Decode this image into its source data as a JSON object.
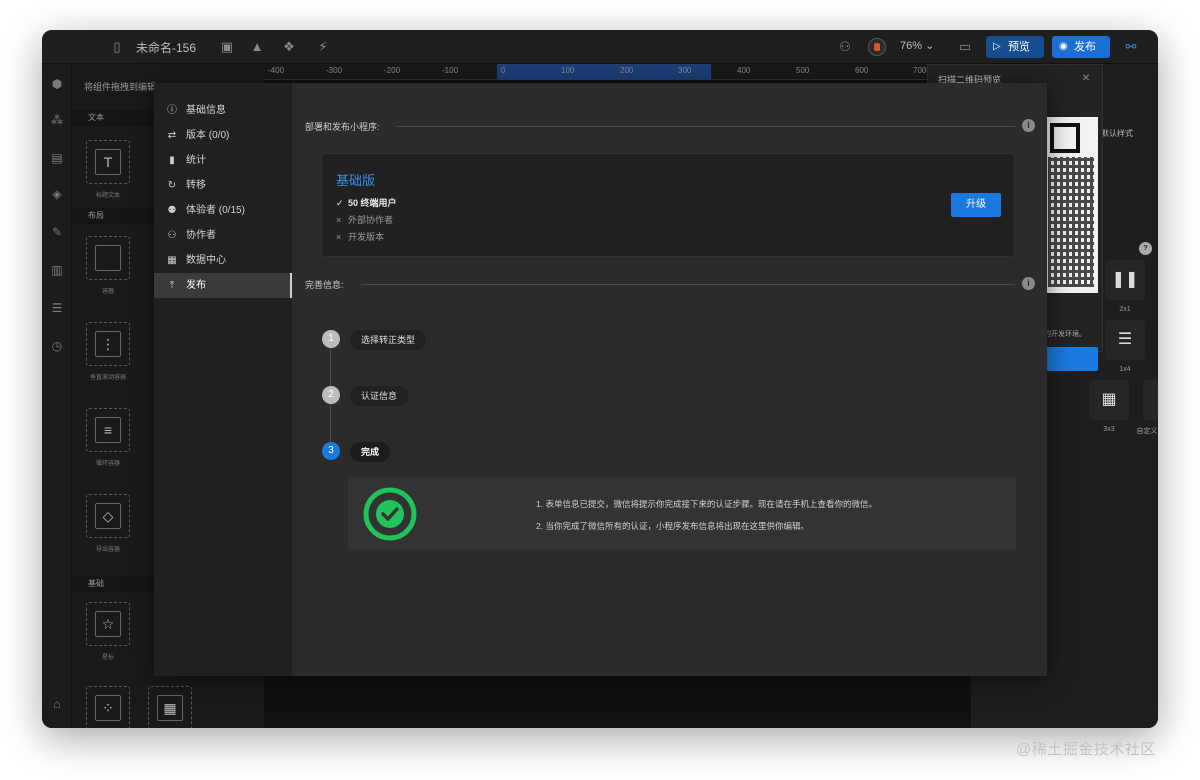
{
  "toolbar": {
    "doc_title": "未命名-156",
    "zoom": "76%",
    "preview_label": "预览",
    "publish_label": "发布"
  },
  "ruler": {
    "ticks": [
      "-400",
      "-300",
      "-200",
      "-100",
      "0",
      "100",
      "200",
      "300",
      "400",
      "500",
      "600",
      "700"
    ]
  },
  "component_panel": {
    "hint": "将组件拖拽到编辑",
    "sections": [
      "文本",
      "布局",
      "基础"
    ],
    "cards": [
      {
        "label": "标题文本"
      },
      {
        "label": "容器"
      },
      {
        "label": "垂直滚动容器"
      },
      {
        "label": "循环容器"
      },
      {
        "label": "导出容器"
      },
      {
        "label": "星标"
      },
      {
        "label": ""
      },
      {
        "label": ""
      }
    ]
  },
  "qr_popover": {
    "title": "扫描二维码预览",
    "note": "的开发环境。"
  },
  "props_panel": {
    "style_select": "默认样式",
    "tiles": [
      {
        "label": "2x1"
      },
      {
        "label": "1x4"
      },
      {
        "label": "3x3"
      },
      {
        "label": "自定义"
      }
    ]
  },
  "modal": {
    "nav": [
      {
        "label": "基础信息",
        "icon": "info-icon"
      },
      {
        "label": "版本 (0/0)",
        "icon": "swap-icon"
      },
      {
        "label": "统计",
        "icon": "bar-chart-icon"
      },
      {
        "label": "转移",
        "icon": "transfer-icon"
      },
      {
        "label": "体验者 (0/15)",
        "icon": "user-plus-icon"
      },
      {
        "label": "协作者",
        "icon": "team-icon"
      },
      {
        "label": "数据中心",
        "icon": "table-icon"
      },
      {
        "label": "发布",
        "icon": "upload-icon",
        "active": true
      }
    ],
    "deploy_section": "部署和发布小程序:",
    "plan": {
      "name": "基础版",
      "features": [
        {
          "mark": "✓",
          "text": "50 终端用户",
          "enabled": true
        },
        {
          "mark": "×",
          "text": "外部协作者",
          "enabled": false
        },
        {
          "mark": "×",
          "text": "开发版本",
          "enabled": false
        }
      ],
      "upgrade_label": "升级"
    },
    "info_section": "完善信息:",
    "steps": [
      {
        "num": "1",
        "label": "选择转正类型",
        "current": false
      },
      {
        "num": "2",
        "label": "认证信息",
        "current": false
      },
      {
        "num": "3",
        "label": "完成",
        "current": true
      }
    ],
    "done_messages": [
      "1. 表单信息已提交，微信将提示你完成接下来的认证步骤。现在请在手机上查看你的微信。",
      "2. 当你完成了微信所有的认证，小程序发布信息将出现在这里供你编辑。"
    ],
    "accent": "#1a7ae0",
    "success": "#21c35b"
  },
  "watermark": "@稀土掘金技术社区"
}
